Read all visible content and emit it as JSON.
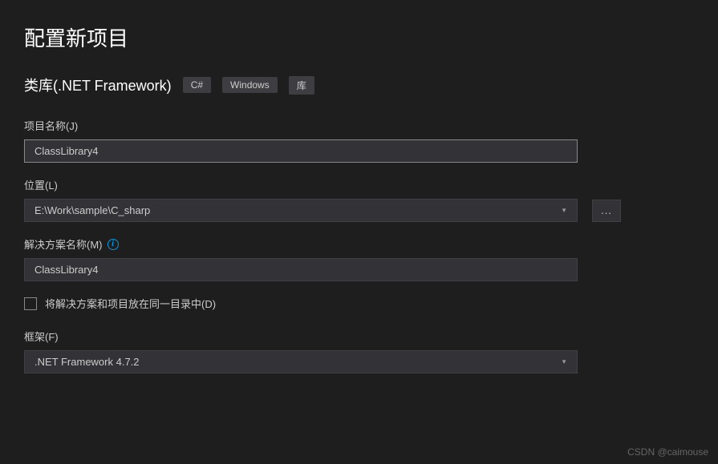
{
  "header": {
    "title": "配置新项目",
    "subtitle": "类库(.NET Framework)",
    "tags": [
      "C#",
      "Windows",
      "库"
    ]
  },
  "fields": {
    "project_name": {
      "label": "项目名称(J)",
      "value": "ClassLibrary4"
    },
    "location": {
      "label": "位置(L)",
      "value": "E:\\Work\\sample\\C_sharp",
      "browse_label": "..."
    },
    "solution_name": {
      "label": "解决方案名称(M)",
      "value": "ClassLibrary4"
    },
    "same_dir_checkbox": {
      "label": "将解决方案和项目放在同一目录中(D)"
    },
    "framework": {
      "label": "框架(F)",
      "value": ".NET Framework 4.7.2"
    }
  },
  "watermark": "CSDN @caimouse"
}
